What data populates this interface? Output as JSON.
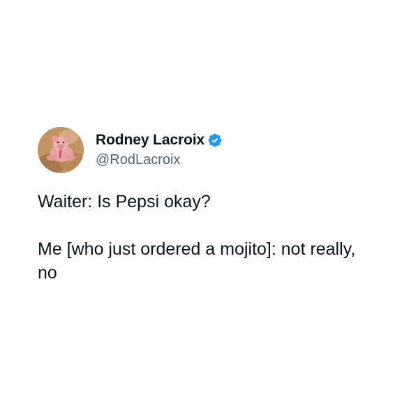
{
  "tweet": {
    "author": {
      "display_name": "Rodney Lacroix",
      "handle": "@RodLacroix",
      "verified": true,
      "avatar_icon": "pig-figurine-avatar"
    },
    "text": {
      "line_1": "Waiter: Is Pepsi okay?",
      "line_2": "Me [who just ordered a mojito]: not really, no"
    },
    "colors": {
      "name": "#0f1419",
      "handle": "#536471",
      "verified_badge": "#1d9bf0",
      "background": "#ffffff"
    }
  }
}
